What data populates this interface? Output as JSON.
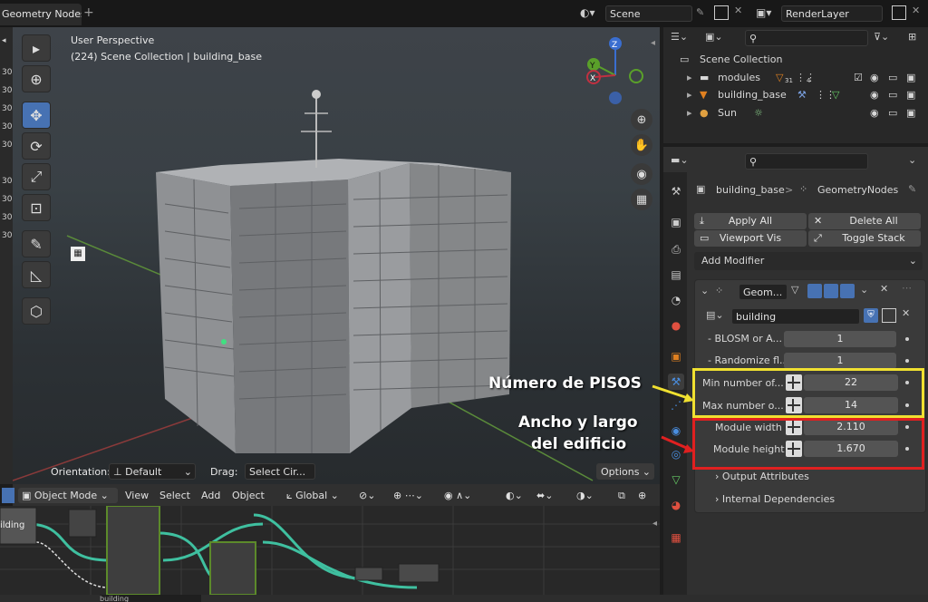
{
  "topbar": {
    "workspace_tab": "Geometry Nodes",
    "add_tab": "+",
    "scene_name": "Scene",
    "renderlayer_name": "RenderLayer"
  },
  "viewport": {
    "view_name": "User Perspective",
    "collection_info": "(224) Scene Collection | building_base",
    "orientation_label": "Orientation:",
    "orientation_value": "Default",
    "drag_label": "Drag:",
    "drag_value": "Select Cir...",
    "options_label": "Options",
    "gizmo": {
      "z": "Z",
      "y": "Y",
      "x": "X"
    },
    "left_gutter_numbers": [
      "30",
      "30",
      "30",
      "30",
      "30",
      "30",
      "30",
      "30",
      "30"
    ]
  },
  "header3d": {
    "mode": "Object Mode",
    "menus": [
      "View",
      "Select",
      "Add",
      "Object"
    ],
    "transform_orientation": "Global"
  },
  "node_editor": {
    "node_label": "ilding",
    "bottom_field": "building"
  },
  "outliner": {
    "collection": "Scene Collection",
    "items": [
      {
        "name": "modules",
        "badge": "31",
        "badge2": "4"
      },
      {
        "name": "building_base"
      },
      {
        "name": "Sun"
      }
    ]
  },
  "properties": {
    "breadcrumb_object": "building_base",
    "breadcrumb_sep": ">",
    "breadcrumb_modifier": "GeometryNodes",
    "apply_all": "Apply All",
    "delete_all": "Delete All",
    "viewport_vis": "Viewport Vis",
    "toggle_stack": "Toggle Stack",
    "add_modifier": "Add Modifier",
    "modifier_name": "Geom...",
    "node_group": "building",
    "inputs": [
      {
        "label": "- BLOSM or A...",
        "value": "1"
      },
      {
        "label": "- Randomize fl...",
        "value": "1"
      },
      {
        "label": "Min number of...",
        "value": "22"
      },
      {
        "label": "Max number o...",
        "value": "14"
      },
      {
        "label": "Module width",
        "value": "2.110"
      },
      {
        "label": "Module height",
        "value": "1.670"
      }
    ],
    "output_attributes": "Output Attributes",
    "internal_dependencies": "Internal Dependencies"
  },
  "annotations": {
    "floors": "Número de PISOS",
    "size_line1": "Ancho y largo",
    "size_line2": "del edificio",
    "yellow": "#f0e030",
    "red": "#e02020"
  }
}
